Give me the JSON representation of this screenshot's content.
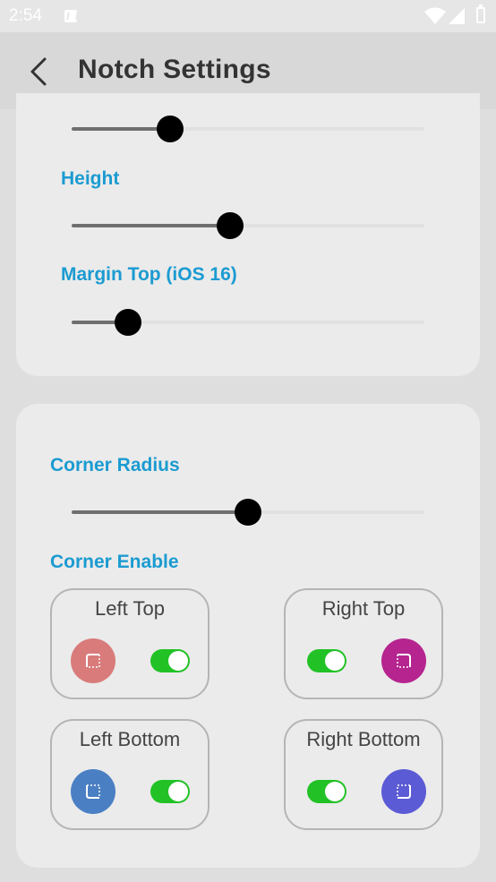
{
  "status_bar": {
    "time": "2:54"
  },
  "app_bar": {
    "title": "Notch Settings"
  },
  "notch_card": {
    "width_slider": {
      "fraction": 0.28
    },
    "height": {
      "label": "Height",
      "fraction": 0.45
    },
    "margin_top": {
      "label": "Margin Top (iOS 16)",
      "fraction": 0.16
    }
  },
  "corner_card": {
    "corner_radius": {
      "label": "Corner Radius",
      "fraction": 0.5
    },
    "corner_enable": {
      "label": "Corner Enable"
    },
    "corners": [
      {
        "label": "Left Top",
        "color": "#d97b7b",
        "icon": "corner-left-top-icon",
        "enabled": true
      },
      {
        "label": "Right Top",
        "color": "#b5248f",
        "icon": "corner-right-top-icon",
        "enabled": true
      },
      {
        "label": "Left Bottom",
        "color": "#4a7fc3",
        "icon": "corner-left-bottom-icon",
        "enabled": true
      },
      {
        "label": "Right Bottom",
        "color": "#5b5bd6",
        "icon": "corner-right-bottom-icon",
        "enabled": true
      }
    ]
  }
}
